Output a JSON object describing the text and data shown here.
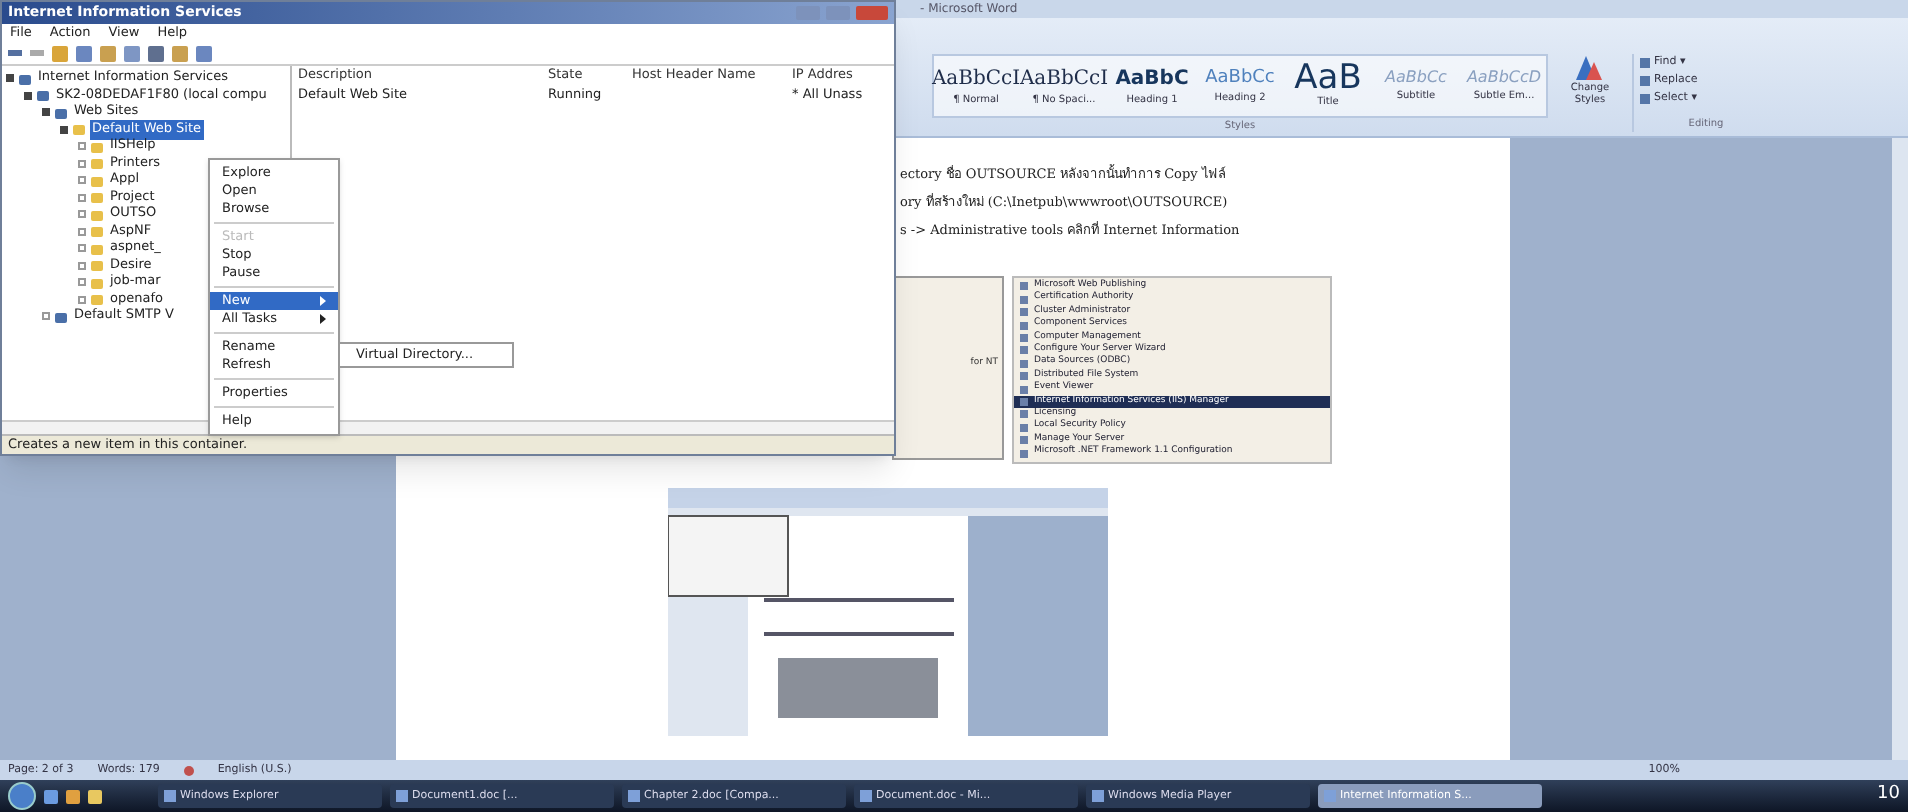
{
  "word": {
    "title": "- Microsoft Word",
    "styles": [
      {
        "preview": "AaBbCcI",
        "name": "¶ Normal",
        "kind": "normal"
      },
      {
        "preview": "AaBbCcI",
        "name": "¶ No Spaci...",
        "kind": "normal"
      },
      {
        "preview": "AaBbC",
        "name": "Heading 1",
        "kind": "heading1"
      },
      {
        "preview": "AaBbCc",
        "name": "Heading 2",
        "kind": "heading2"
      },
      {
        "preview": "AaB",
        "name": "Title",
        "kind": "title"
      },
      {
        "preview": "AaBbCc",
        "name": "Subtitle",
        "kind": "subtitle"
      },
      {
        "preview": "AaBbCcD",
        "name": "Subtle Em...",
        "kind": "subtitle"
      }
    ],
    "styles_group": "Styles",
    "change_styles": "Change Styles",
    "editing": {
      "label": "Editing",
      "buttons": [
        "Find ▾",
        "Replace",
        "Select ▾"
      ]
    },
    "document_lines": [
      "ectory ชื่อ OUTSOURCE หลังจากนั้นทำการ Copy ไฟล์",
      "ory ที่สร้างใหม่ (C:\\Inetpub\\wwwroot\\OUTSOURCE)",
      "s -> Administrative tools คลิกที่ Internet Information"
    ],
    "figure": {
      "left_text": "for NT",
      "items": [
        {
          "label": "Microsoft Web Publishing",
          "selected": false
        },
        {
          "label": "Certification Authority",
          "selected": false
        },
        {
          "label": "Cluster Administrator",
          "selected": false
        },
        {
          "label": "Component Services",
          "selected": false
        },
        {
          "label": "Computer Management",
          "selected": false
        },
        {
          "label": "Configure Your Server Wizard",
          "selected": false
        },
        {
          "label": "Data Sources (ODBC)",
          "selected": false
        },
        {
          "label": "Distributed File System",
          "selected": false
        },
        {
          "label": "Event Viewer",
          "selected": false
        },
        {
          "label": "Internet Information Services (IIS) Manager",
          "selected": true
        },
        {
          "label": "Licensing",
          "selected": false
        },
        {
          "label": "Local Security Policy",
          "selected": false
        },
        {
          "label": "Manage Your Server",
          "selected": false
        },
        {
          "label": "Microsoft .NET Framework 1.1 Configuration",
          "selected": false
        }
      ]
    },
    "status_bar": {
      "page": "Page: 2 of 3",
      "words": "Words: 179",
      "language": "English (U.S.)",
      "zoom": "100%"
    }
  },
  "iis": {
    "title": "Internet Information Services",
    "menu": [
      "File",
      "Action",
      "View",
      "Help"
    ],
    "tree": [
      {
        "label": "Internet Information Services",
        "selected": false,
        "expanded": true,
        "children": [
          {
            "label": "SK2-08DEDAF1F80 (local compu",
            "selected": false,
            "expanded": true,
            "children": [
              {
                "label": "Web Sites",
                "selected": false,
                "expanded": true,
                "children": [
                  {
                    "label": "Default Web Site",
                    "selected": true,
                    "expanded": true,
                    "children": [
                      {
                        "label": "IISHelp",
                        "selected": false,
                        "expanded": false
                      },
                      {
                        "label": "Printers",
                        "selected": false,
                        "expanded": false
                      },
                      {
                        "label": "Appl",
                        "selected": false,
                        "expanded": false
                      },
                      {
                        "label": "Project",
                        "selected": false,
                        "expanded": false
                      },
                      {
                        "label": "OUTSO",
                        "selected": false,
                        "expanded": false
                      },
                      {
                        "label": "AspNF",
                        "selected": false,
                        "expanded": false
                      },
                      {
                        "label": "aspnet_",
                        "selected": false,
                        "expanded": false
                      },
                      {
                        "label": "Desire",
                        "selected": false,
                        "expanded": false
                      },
                      {
                        "label": "job-mar",
                        "selected": false,
                        "expanded": false
                      },
                      {
                        "label": "openafo",
                        "selected": false,
                        "expanded": false
                      }
                    ]
                  }
                ]
              },
              {
                "label": "Default SMTP V",
                "selected": false,
                "expanded": false
              }
            ]
          }
        ]
      }
    ],
    "columns": [
      "Description",
      "State",
      "Host Header Name",
      "IP Addres"
    ],
    "rows": [
      [
        "Default Web Site",
        "Running",
        "",
        "* All Unass"
      ]
    ],
    "status": "Creates a new item in this container.",
    "context_menu": [
      {
        "kind": "item",
        "label": "Explore",
        "disabled": false,
        "selected": false
      },
      {
        "kind": "item",
        "label": "Open",
        "disabled": false,
        "selected": false
      },
      {
        "kind": "item",
        "label": "Browse",
        "disabled": false,
        "selected": false
      },
      {
        "kind": "separator"
      },
      {
        "kind": "item",
        "label": "Start",
        "disabled": true,
        "selected": false
      },
      {
        "kind": "item",
        "label": "Stop",
        "disabled": false,
        "selected": false
      },
      {
        "kind": "item",
        "label": "Pause",
        "disabled": false,
        "selected": false
      },
      {
        "kind": "separator"
      },
      {
        "kind": "submenu",
        "label": "New",
        "disabled": false,
        "selected": true
      },
      {
        "kind": "submenu",
        "label": "All Tasks",
        "disabled": false,
        "selected": false
      },
      {
        "kind": "separator"
      },
      {
        "kind": "item",
        "label": "Rename",
        "disabled": false,
        "selected": false
      },
      {
        "kind": "item",
        "label": "Refresh",
        "disabled": false,
        "selected": false
      },
      {
        "kind": "separator"
      },
      {
        "kind": "item",
        "label": "Properties",
        "disabled": false,
        "selected": false
      },
      {
        "kind": "separator"
      },
      {
        "kind": "item",
        "label": "Help",
        "disabled": false,
        "selected": false
      }
    ],
    "submenu": [
      "Virtual Directory..."
    ]
  },
  "taskbar": {
    "tasks": [
      {
        "label": "Windows Explorer",
        "selected": false
      },
      {
        "label": "Document1.doc [...",
        "selected": false
      },
      {
        "label": "Chapter 2.doc [Compa...",
        "selected": false
      },
      {
        "label": "Document.doc - Mi...",
        "selected": false
      },
      {
        "label": "Windows Media Player",
        "selected": false
      },
      {
        "label": "Internet Information S...",
        "selected": true
      }
    ],
    "clock": "10"
  }
}
